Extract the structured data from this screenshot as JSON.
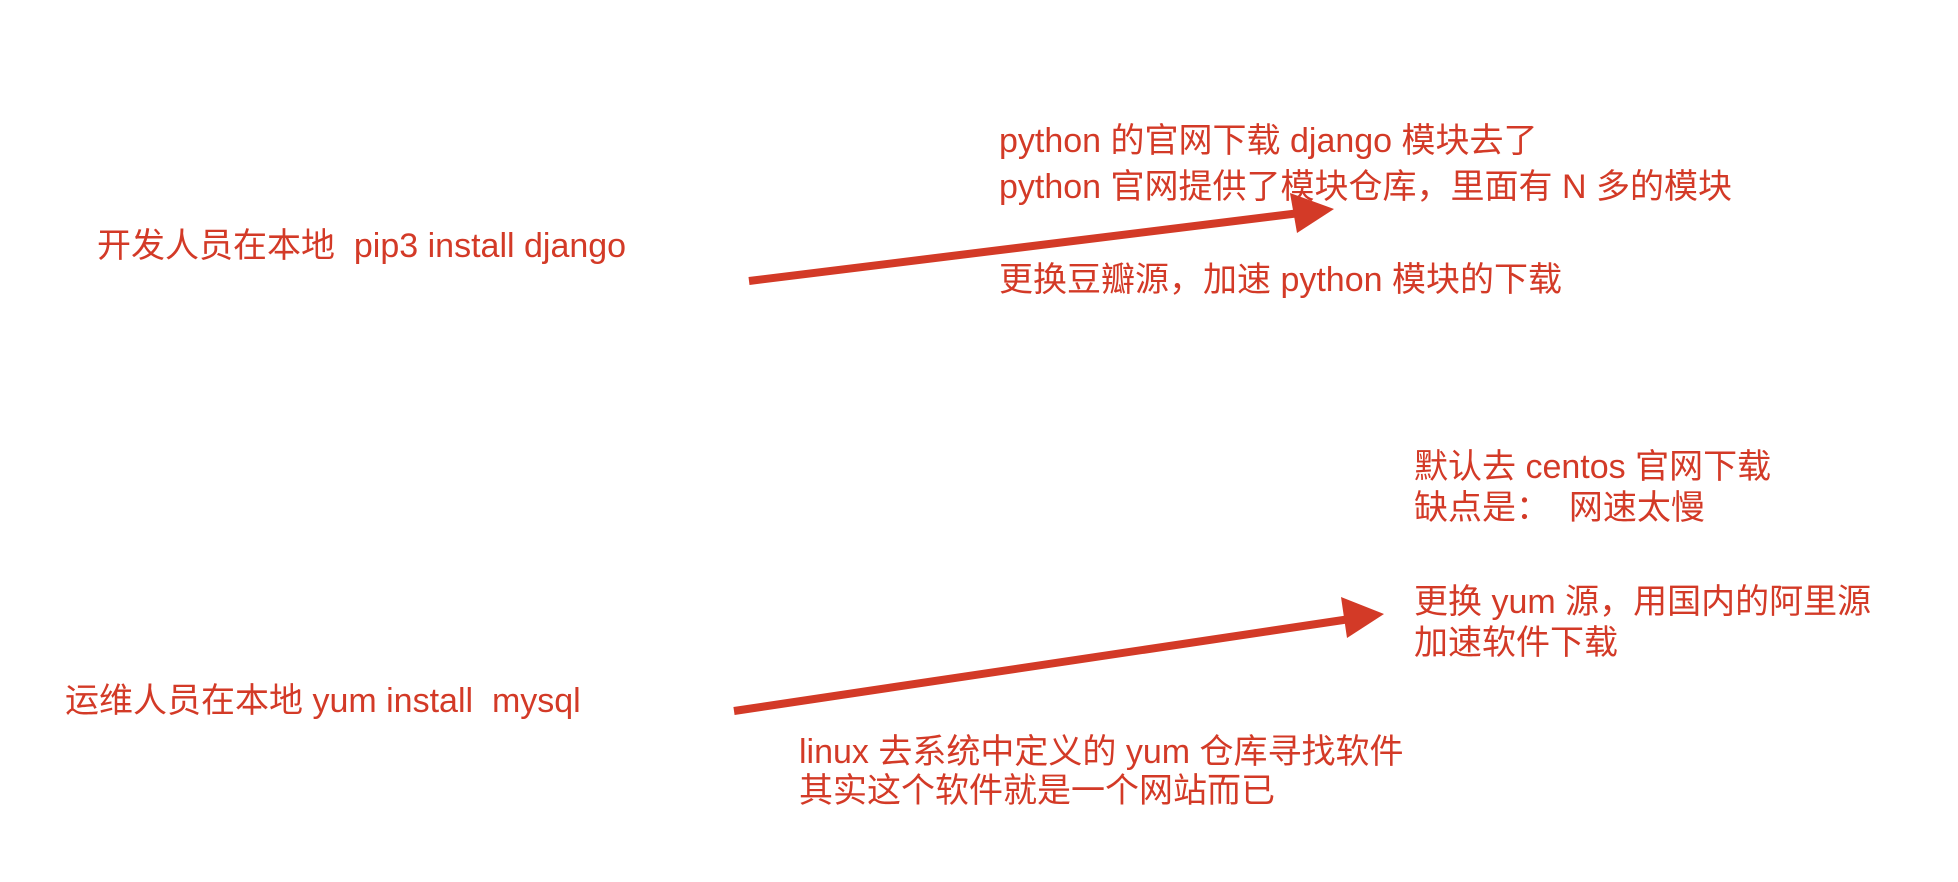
{
  "colors": {
    "ink": "#d33a27",
    "background": "#ffffff"
  },
  "dev": {
    "source": "开发人员在本地  pip3 install django",
    "notes": [
      "python 的官网下载 django 模块去了",
      "python 官网提供了模块仓库，里面有 N 多的模块"
    ],
    "solution": "更换豆瓣源，加速 python 模块的下载"
  },
  "ops": {
    "source": "运维人员在本地 yum install  mysql",
    "notes": [
      "默认去 centos 官网下载",
      "缺点是：  网速太慢"
    ],
    "solution": [
      "更换 yum 源，用国内的阿里源",
      "加速软件下载"
    ],
    "explanation": [
      "linux 去系统中定义的 yum 仓库寻找软件",
      "其实这个软件就是一个网站而已"
    ]
  }
}
